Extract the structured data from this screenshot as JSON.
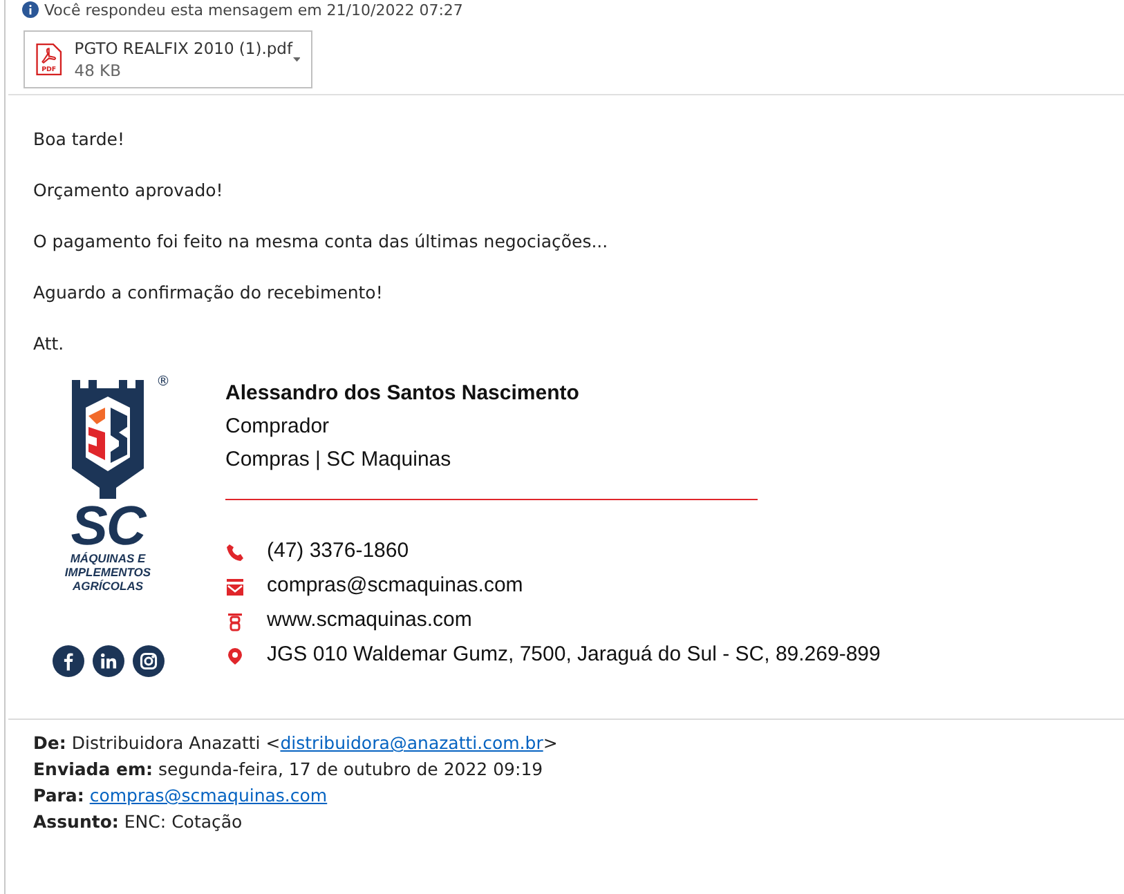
{
  "notice": "Você respondeu esta mensagem em 21/10/2022 07:27",
  "attachment": {
    "name": "PGTO REALFIX 2010 (1).pdf",
    "size": "48 KB",
    "icon_label": "PDF"
  },
  "body": [
    "Boa tarde!",
    "Orçamento aprovado!",
    "O pagamento foi feito na mesma conta das últimas negociações...",
    "Aguardo a confirmação do recebimento!",
    "Att."
  ],
  "logo": {
    "mark": "SC",
    "registered": "®",
    "tagline": [
      "MÁQUINAS E",
      "IMPLEMENTOS",
      "AGRÍCOLAS"
    ]
  },
  "social": [
    {
      "kind": "facebook"
    },
    {
      "kind": "linkedin"
    },
    {
      "kind": "instagram"
    }
  ],
  "signature": {
    "name": "Alessandro dos Santos Nascimento",
    "role": "Comprador",
    "department": "Compras | SC Maquinas"
  },
  "contacts": [
    {
      "kind": "phone",
      "text": "(47) 3376-1860"
    },
    {
      "kind": "email",
      "text": "compras@scmaquinas.com"
    },
    {
      "kind": "web",
      "text": "www.scmaquinas.com"
    },
    {
      "kind": "address",
      "text": "JGS 010 Waldemar Gumz, 7500, Jaraguá do Sul - SC, 89.269-899"
    }
  ],
  "header": [
    {
      "label": "De:",
      "text": "Distribuidora Anazatti <",
      "link": "distribuidora@anazatti.com.br",
      "after": ">"
    },
    {
      "label": "Enviada em:",
      "text": "segunda-feira, 17 de outubro de 2022 09:19"
    },
    {
      "label": "Para:",
      "link": "compras@scmaquinas.com"
    },
    {
      "label": "Assunto:",
      "text": "ENC: Cotação"
    }
  ]
}
